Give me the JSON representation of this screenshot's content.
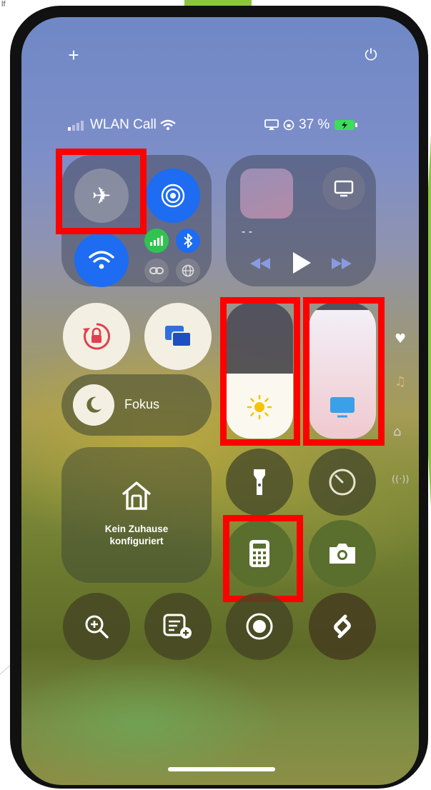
{
  "slide": {
    "corner_text": "lf"
  },
  "status": {
    "plus": "+",
    "power": "⏻",
    "carrier": "WLAN Call",
    "battery_percent": "37 %"
  },
  "connectivity": {
    "airplane": "✈",
    "airdrop": "◎",
    "wifi": "📶",
    "cellular": "📶",
    "bluetooth": "✱",
    "link": "⛓",
    "globe": "🌐"
  },
  "media": {
    "track": "- -",
    "prev": "⏪",
    "play": "▶",
    "next": "⏩"
  },
  "controls": {
    "rotation_lock": "🔒",
    "screen_mirror": "⧉",
    "focus_label": "Fokus",
    "home_label": "Kein Zuhause konfiguriert",
    "flashlight": "🔦",
    "timer": "⏱",
    "calculator": "▦",
    "camera": "📷",
    "magnifier": "🔍",
    "notes": "📝",
    "record": "●",
    "shazam": "S"
  },
  "sliders": {
    "brightness_level": 0.48,
    "volume_level": 0.95
  },
  "colors": {
    "accent_blue": "#1d6cf2",
    "highlight_red": "#ff0000",
    "slide_green": "#8cc63f"
  }
}
